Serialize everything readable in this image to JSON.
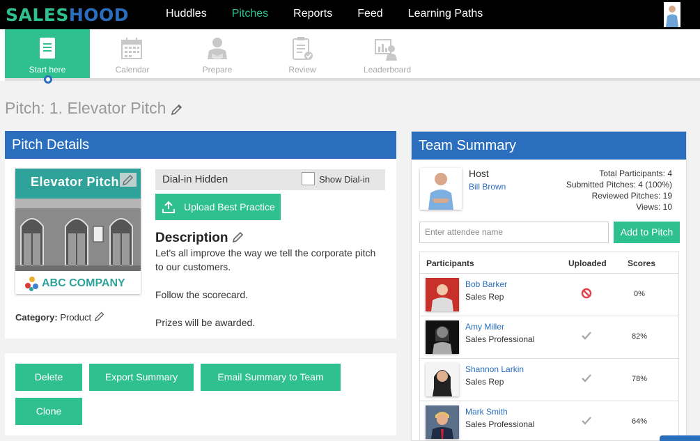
{
  "app": {
    "logo_part1": "SALES",
    "logo_part2": "HOOD"
  },
  "nav": {
    "items": [
      {
        "label": "Huddles"
      },
      {
        "label": "Pitches"
      },
      {
        "label": "Reports"
      },
      {
        "label": "Feed"
      },
      {
        "label": "Learning Paths"
      }
    ],
    "active": "Pitches"
  },
  "subtabs": [
    {
      "label": "Start here",
      "icon": "document-icon"
    },
    {
      "label": "Calendar",
      "icon": "calendar-icon"
    },
    {
      "label": "Prepare",
      "icon": "prepare-icon"
    },
    {
      "label": "Review",
      "icon": "review-icon"
    },
    {
      "label": "Leaderboard",
      "icon": "leaderboard-icon"
    }
  ],
  "pitch": {
    "title": "Pitch: 1. Elevator Pitch"
  },
  "details": {
    "header": "Pitch Details",
    "thumbnail_title": "Elevator Pitch",
    "thumbnail_company": "ABC COMPANY",
    "category_label": "Category:",
    "category_value": "Product",
    "dial_status": "Dial-in Hidden",
    "show_dial_label": "Show Dial-in",
    "show_dial_checked": false,
    "upload_label": "Upload Best Practice",
    "description_heading": "Description",
    "description_lines": [
      "Let's all improve the way we tell the corporate pitch to our customers.",
      "Follow the scorecard.",
      "Prizes will be awarded."
    ]
  },
  "actions": {
    "delete": "Delete",
    "export": "Export Summary",
    "email": "Email Summary to Team",
    "clone": "Clone"
  },
  "team": {
    "header": "Team Summary",
    "host_label": "Host",
    "host_name": "Bill Brown",
    "stats": [
      "Total Participants: 4",
      "Submitted Pitches: 4 (100%)",
      "Reviewed Pitches: 19",
      "Views: 10"
    ],
    "attendee_placeholder": "Enter attendee name",
    "add_button": "Add to Pitch",
    "columns": [
      "Participants",
      "Uploaded",
      "Scores"
    ],
    "participants": [
      {
        "name": "Bob Barker",
        "role": "Sales Rep",
        "uploaded": "blocked",
        "score": "0%"
      },
      {
        "name": "Amy Miller",
        "role": "Sales Professional",
        "uploaded": "check",
        "score": "82%"
      },
      {
        "name": "Shannon Larkin",
        "role": "Sales Rep",
        "uploaded": "check",
        "score": "78%"
      },
      {
        "name": "Mark Smith",
        "role": "Sales Professional",
        "uploaded": "check",
        "score": "64%"
      }
    ]
  },
  "colors": {
    "brand_green": "#2fc08f",
    "brand_blue": "#2a6ebd",
    "block_red": "#e0424b"
  }
}
